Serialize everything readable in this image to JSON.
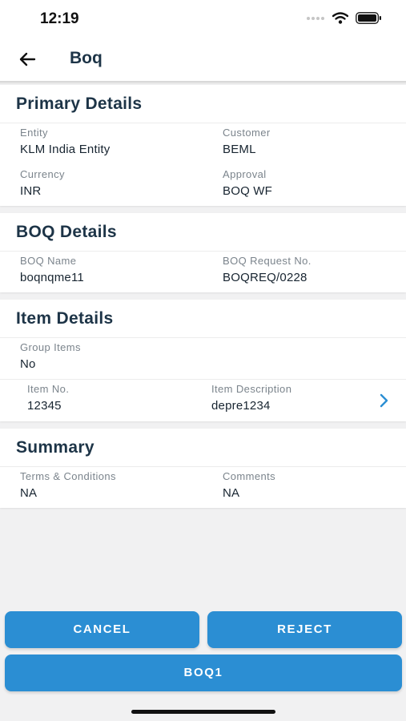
{
  "status_bar": {
    "time": "12:19"
  },
  "header": {
    "title": "Boq"
  },
  "sections": {
    "primary": {
      "title": "Primary Details",
      "entity_label": "Entity",
      "entity_value": "KLM India Entity",
      "customer_label": "Customer",
      "customer_value": "BEML",
      "currency_label": "Currency",
      "currency_value": "INR",
      "approval_label": "Approval",
      "approval_value": "BOQ WF"
    },
    "boq": {
      "title": "BOQ Details",
      "name_label": "BOQ Name",
      "name_value": "boqnqme11",
      "request_label": "BOQ Request No.",
      "request_value": "BOQREQ/0228"
    },
    "items": {
      "title": "Item Details",
      "group_label": "Group Items",
      "group_value": "No",
      "item_no_label": "Item No.",
      "item_no_value": "12345",
      "item_desc_label": "Item Description",
      "item_desc_value": "depre1234"
    },
    "summary": {
      "title": "Summary",
      "terms_label": "Terms & Conditions",
      "terms_value": "NA",
      "comments_label": "Comments",
      "comments_value": "NA"
    }
  },
  "actions": {
    "cancel": "CANCEL",
    "reject": "REJECT",
    "boq1": "BOQ1"
  },
  "colors": {
    "accent": "#2b8ed3",
    "heading": "#1d3447",
    "background": "#f1f1f2"
  },
  "icons": {
    "back": "arrow-left",
    "chevron": "chevron-right",
    "wifi": "wifi",
    "battery": "battery"
  }
}
